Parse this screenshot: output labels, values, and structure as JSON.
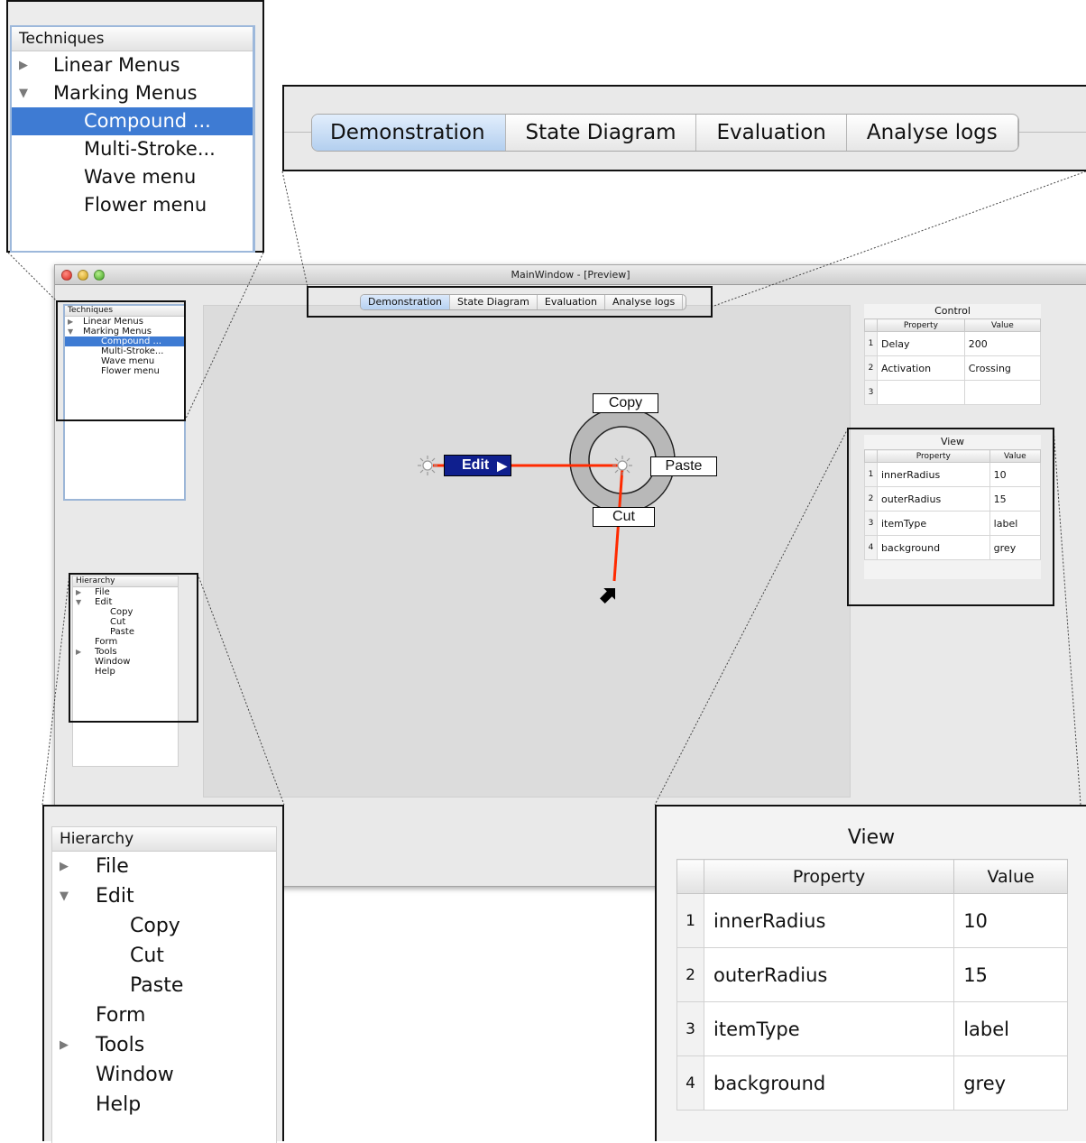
{
  "window": {
    "title": "MainWindow - [Preview]"
  },
  "tabs": [
    "Demonstration",
    "State Diagram",
    "Evaluation",
    "Analyse logs"
  ],
  "techniques": {
    "header": "Techniques",
    "items": [
      {
        "label": "Linear Menus",
        "expander": "collapsed"
      },
      {
        "label": "Marking Menus",
        "expander": "expanded"
      },
      {
        "label": "Compound ...",
        "selected": true
      },
      {
        "label": "Multi-Stroke..."
      },
      {
        "label": "Wave menu"
      },
      {
        "label": "Flower menu"
      }
    ]
  },
  "hierarchy": {
    "header": "Hierarchy",
    "items": [
      {
        "label": "File",
        "expander": "collapsed"
      },
      {
        "label": "Edit",
        "expander": "expanded"
      },
      {
        "label": "Copy"
      },
      {
        "label": "Cut"
      },
      {
        "label": "Paste"
      },
      {
        "label": "Form"
      },
      {
        "label": "Tools",
        "expander": "collapsed"
      },
      {
        "label": "Window"
      },
      {
        "label": "Help"
      }
    ]
  },
  "control": {
    "title": "Control",
    "columns": [
      "Property",
      "Value"
    ],
    "rows": [
      {
        "index": "1",
        "property": "Delay",
        "value": "200"
      },
      {
        "index": "2",
        "property": "Activation",
        "value": "Crossing"
      },
      {
        "index": "3",
        "property": "",
        "value": ""
      }
    ]
  },
  "view": {
    "title": "View",
    "columns": [
      "Property",
      "Value"
    ],
    "rows": [
      {
        "index": "1",
        "property": "innerRadius",
        "value": "10"
      },
      {
        "index": "2",
        "property": "outerRadius",
        "value": "15"
      },
      {
        "index": "3",
        "property": "itemType",
        "value": "label"
      },
      {
        "index": "4",
        "property": "background",
        "value": "grey"
      }
    ]
  },
  "marking_menu": {
    "parent": "Edit",
    "items": [
      "Copy",
      "Paste",
      "Cut"
    ]
  },
  "colors": {
    "selection": "#3e7bd3",
    "stroke": "#ff2a00",
    "edit_item": "#0f1f8e",
    "ring": "#b8b8b8"
  }
}
